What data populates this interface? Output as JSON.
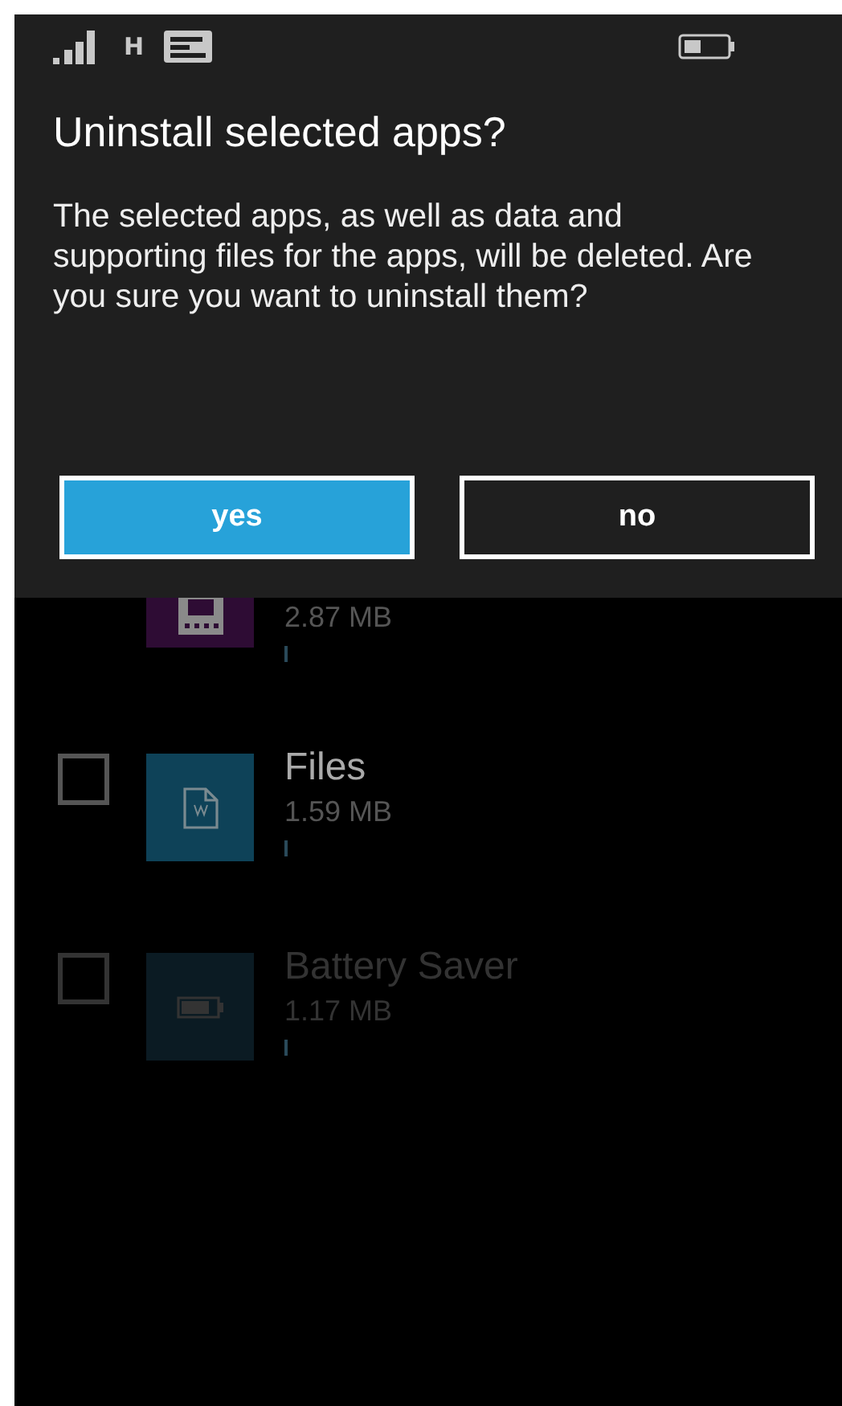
{
  "status_bar": {
    "network": "H"
  },
  "dialog": {
    "title": "Uninstall selected apps?",
    "message": "The selected apps, as well as data and supporting files for the apps, will be deleted. Are you sure you want to uninstall them?",
    "buttons": [
      {
        "label": "yes",
        "selected": true
      },
      {
        "label": "no",
        "selected": false
      }
    ]
  },
  "apps": [
    {
      "kind": "storage",
      "size": "2.87 MB",
      "color": "#2e0c34"
    },
    {
      "kind": "file",
      "name": "Files",
      "size": "1.59 MB",
      "color": "#0e4258",
      "checked": false,
      "dimmed": false
    },
    {
      "kind": "battery",
      "name": "Battery Saver",
      "size": "1.17 MB",
      "color": "#0b1b23",
      "checked": false,
      "dimmed": true
    }
  ]
}
